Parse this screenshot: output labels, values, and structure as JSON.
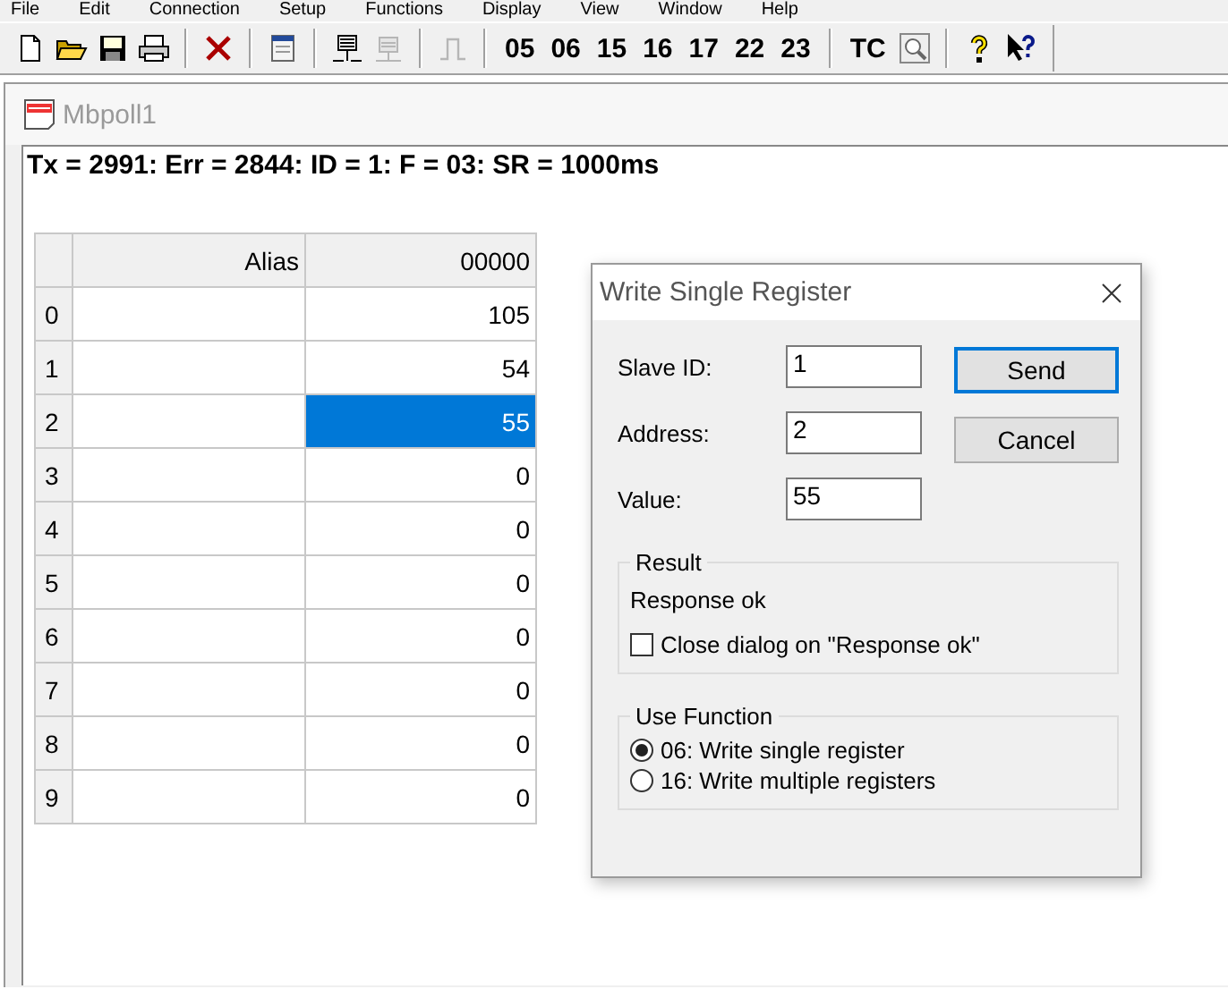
{
  "menu": [
    "File",
    "Edit",
    "Connection",
    "Setup",
    "Functions",
    "Display",
    "View",
    "Window",
    "Help"
  ],
  "toolbar": {
    "function_buttons": [
      "05",
      "06",
      "15",
      "16",
      "17",
      "22",
      "23"
    ],
    "tc_button": "TC"
  },
  "document": {
    "title": "Mbpoll1",
    "status": "Tx = 2991: Err = 2844: ID = 1: F = 03: SR = 1000ms",
    "columns": [
      "Alias",
      "00000"
    ],
    "rows": [
      {
        "index": "0",
        "value": "105",
        "selected": false
      },
      {
        "index": "1",
        "value": "54",
        "selected": false
      },
      {
        "index": "2",
        "value": "55",
        "selected": true
      },
      {
        "index": "3",
        "value": "0",
        "selected": false
      },
      {
        "index": "4",
        "value": "0",
        "selected": false
      },
      {
        "index": "5",
        "value": "0",
        "selected": false
      },
      {
        "index": "6",
        "value": "0",
        "selected": false
      },
      {
        "index": "7",
        "value": "0",
        "selected": false
      },
      {
        "index": "8",
        "value": "0",
        "selected": false
      },
      {
        "index": "9",
        "value": "0",
        "selected": false
      }
    ]
  },
  "dialog": {
    "title": "Write Single Register",
    "fields": [
      {
        "label": "Slave ID:",
        "value": "1"
      },
      {
        "label": "Address:",
        "value": "2"
      },
      {
        "label": "Value:",
        "value": "55"
      }
    ],
    "buttons": [
      {
        "label": "Send",
        "default": true
      },
      {
        "label": "Cancel",
        "default": false
      }
    ],
    "result": {
      "title": "Result",
      "message": "Response ok",
      "checkbox": {
        "label": "Close dialog on \"Response ok\"",
        "checked": false
      }
    },
    "use_function": {
      "title": "Use Function",
      "options": [
        {
          "label": "06: Write single register",
          "selected": true
        },
        {
          "label": "16: Write multiple registers",
          "selected": false
        }
      ]
    }
  }
}
